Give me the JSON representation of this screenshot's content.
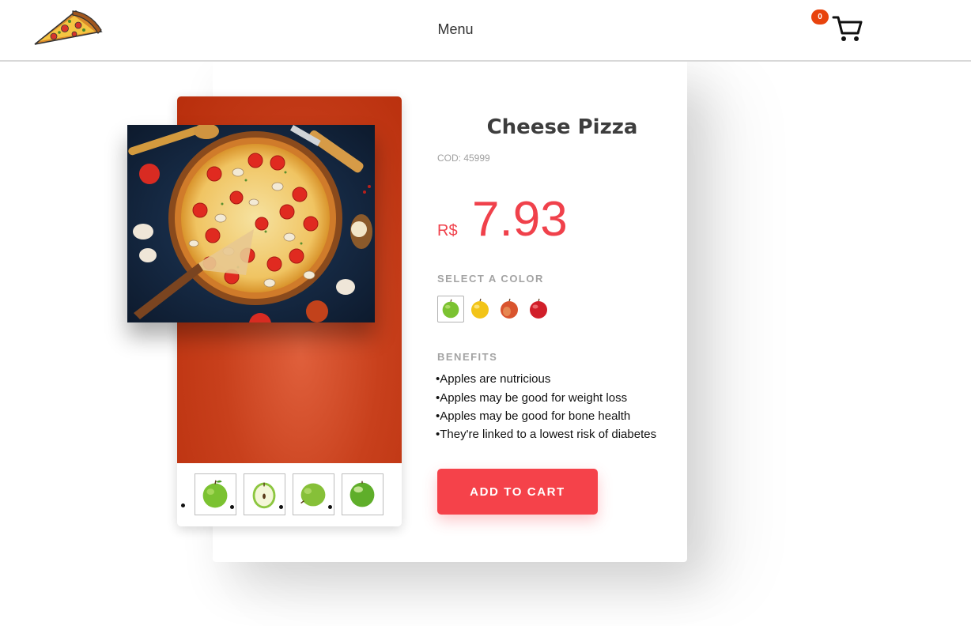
{
  "header": {
    "menu_label": "Menu",
    "cart_count": "0",
    "logo_icon": "pizza-slice-icon",
    "cart_icon": "shopping-cart-icon"
  },
  "product": {
    "name": "Cheese Pizza",
    "code": "COD: 45999",
    "currency": "R$",
    "price": "7.93",
    "color_label": "SELECT A COLOR",
    "colors": [
      "green-apple",
      "yellow-apple",
      "red-apple",
      "dark-red-apple"
    ],
    "selected_color_index": 0,
    "benefits_label": "BENEFITS",
    "benefits": [
      "Apples are nutricious",
      "Apples may be good for weight loss",
      "Apples may be good for bone health",
      "They're linked to a lowest risk of diabetes"
    ],
    "add_to_cart_label": "ADD TO CART"
  },
  "gallery": {
    "thumbnails": [
      "green-apple",
      "halved-green-apple",
      "green-apple-side",
      "green-apple-shiny"
    ]
  },
  "colors": {
    "accent": "#f5424a",
    "badge": "#e8430d",
    "panel": "#c8401c"
  }
}
